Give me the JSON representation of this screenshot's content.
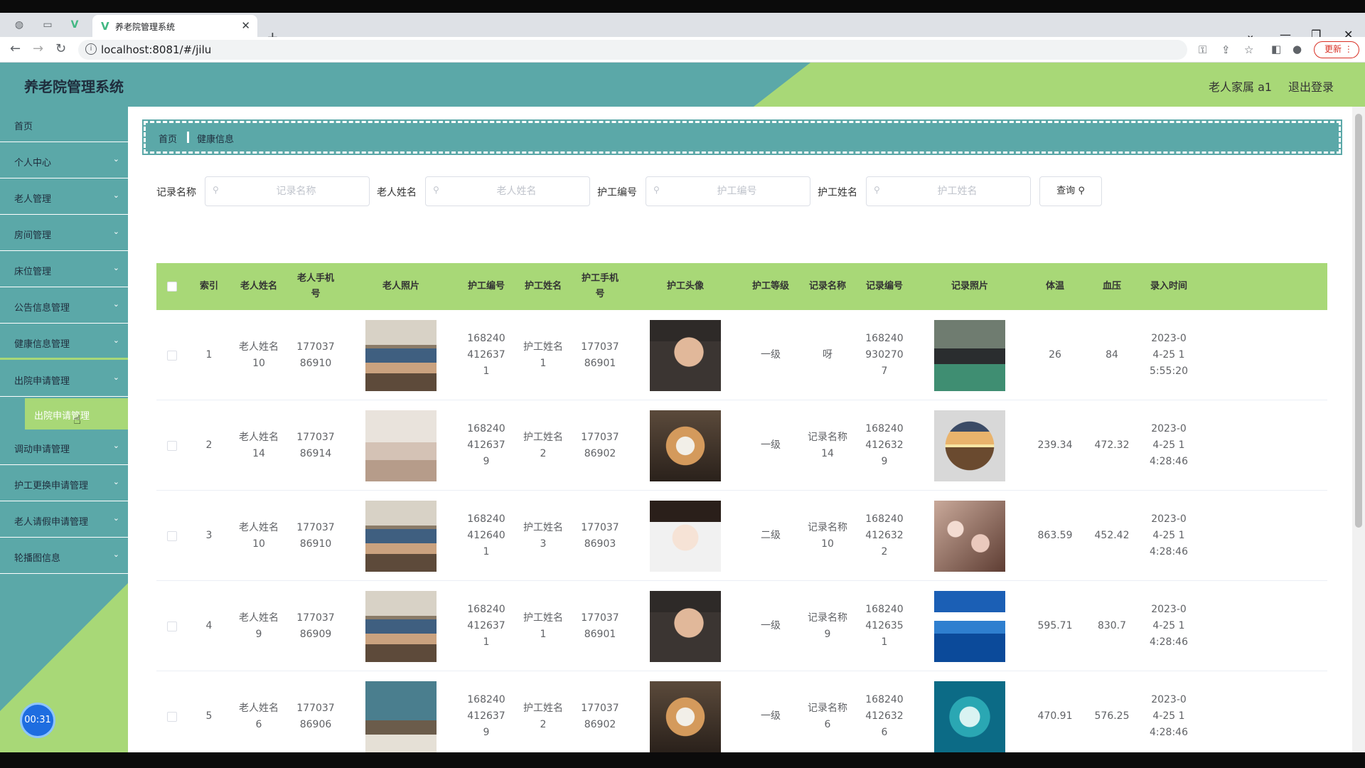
{
  "browser": {
    "tab_title": "养老院管理系统",
    "url": "localhost:8081/#/jilu",
    "update_label": "更新"
  },
  "header": {
    "logo": "养老院管理系统",
    "user": "老人家属 a1",
    "logout": "退出登录"
  },
  "sidebar": {
    "items": [
      {
        "label": "首页",
        "has_chevron": false
      },
      {
        "label": "个人中心",
        "has_chevron": true
      },
      {
        "label": "老人管理",
        "has_chevron": true
      },
      {
        "label": "房间管理",
        "has_chevron": true
      },
      {
        "label": "床位管理",
        "has_chevron": true
      },
      {
        "label": "公告信息管理",
        "has_chevron": true
      },
      {
        "label": "健康信息管理",
        "has_chevron": true
      },
      {
        "label": "出院申请管理",
        "has_chevron": true
      },
      {
        "label": "调动申请管理",
        "has_chevron": true
      },
      {
        "label": "护工更换申请管理",
        "has_chevron": true
      },
      {
        "label": "老人请假申请管理",
        "has_chevron": true
      },
      {
        "label": "轮播图信息",
        "has_chevron": true
      }
    ],
    "sub_item": "出院申请管理",
    "timer": "00:31"
  },
  "breadcrumb": {
    "home": "首页",
    "current": "健康信息"
  },
  "search": {
    "fields": [
      {
        "label": "记录名称",
        "placeholder": "记录名称"
      },
      {
        "label": "老人姓名",
        "placeholder": "老人姓名"
      },
      {
        "label": "护工编号",
        "placeholder": "护工编号"
      },
      {
        "label": "护工姓名",
        "placeholder": "护工姓名"
      }
    ],
    "button": "查询"
  },
  "table": {
    "columns": [
      "索引",
      "老人姓名",
      "老人手机号",
      "老人照片",
      "护工编号",
      "护工姓名",
      "护工手机号",
      "护工头像",
      "护工等级",
      "记录名称",
      "记录编号",
      "记录照片",
      "体温",
      "血压",
      "录入时间"
    ],
    "rows": [
      {
        "index": "1",
        "elder_name": "老人姓名10",
        "elder_phone": "17703786910",
        "elder_photo": "elders-at-table",
        "nurse_id": "1682404126371",
        "nurse_name": "护工姓名1",
        "nurse_phone": "17703786901",
        "nurse_avatar": "young-man",
        "level": "一级",
        "record_name": "呀",
        "record_id": "1682409302707",
        "record_photo": "basketball-team",
        "temperature": "26",
        "pressure": "84",
        "time": "2023-04-25 15:55:20"
      },
      {
        "index": "2",
        "elder_name": "老人姓名14",
        "elder_phone": "17703786914",
        "elder_photo": "caregiver-room",
        "nurse_id": "1682404126379",
        "nurse_name": "护工姓名2",
        "nurse_phone": "17703786902",
        "nurse_avatar": "shiba-dog",
        "level": "一级",
        "record_name": "记录名称14",
        "record_id": "1682404126329",
        "record_photo": "sunset-globe",
        "temperature": "239.34",
        "pressure": "472.32",
        "time": "2023-04-25 14:28:46"
      },
      {
        "index": "3",
        "elder_name": "老人姓名10",
        "elder_phone": "17703786910",
        "elder_photo": "elders-at-table",
        "nurse_id": "1682404126401",
        "nurse_name": "护工姓名3",
        "nurse_phone": "17703786903",
        "nurse_avatar": "woman-portrait",
        "level": "二级",
        "record_name": "记录名称10",
        "record_id": "1682404126322",
        "record_photo": "blossom-branch",
        "temperature": "863.59",
        "pressure": "452.42",
        "time": "2023-04-25 14:28:46"
      },
      {
        "index": "4",
        "elder_name": "老人姓名9",
        "elder_phone": "17703786909",
        "elder_photo": "elders-at-table",
        "nurse_id": "1682404126371",
        "nurse_name": "护工姓名1",
        "nurse_phone": "17703786901",
        "nurse_avatar": "young-man",
        "level": "一级",
        "record_name": "记录名称9",
        "record_id": "1682404126351",
        "record_photo": "sea-sky",
        "temperature": "595.71",
        "pressure": "830.7",
        "time": "2023-04-25 14:28:46"
      },
      {
        "index": "5",
        "elder_name": "老人姓名6",
        "elder_phone": "17703786906",
        "elder_photo": "bedroom",
        "nurse_id": "1682404126379",
        "nurse_name": "护工姓名2",
        "nurse_phone": "17703786902",
        "nurse_avatar": "shiba-dog",
        "level": "一级",
        "record_name": "记录名称6",
        "record_id": "1682404126326",
        "record_photo": "heart-island",
        "temperature": "470.91",
        "pressure": "576.25",
        "time": "2023-04-25 14:28:46"
      }
    ]
  },
  "colors": {
    "teal": "#5ba8a8",
    "green": "#a8d877"
  }
}
